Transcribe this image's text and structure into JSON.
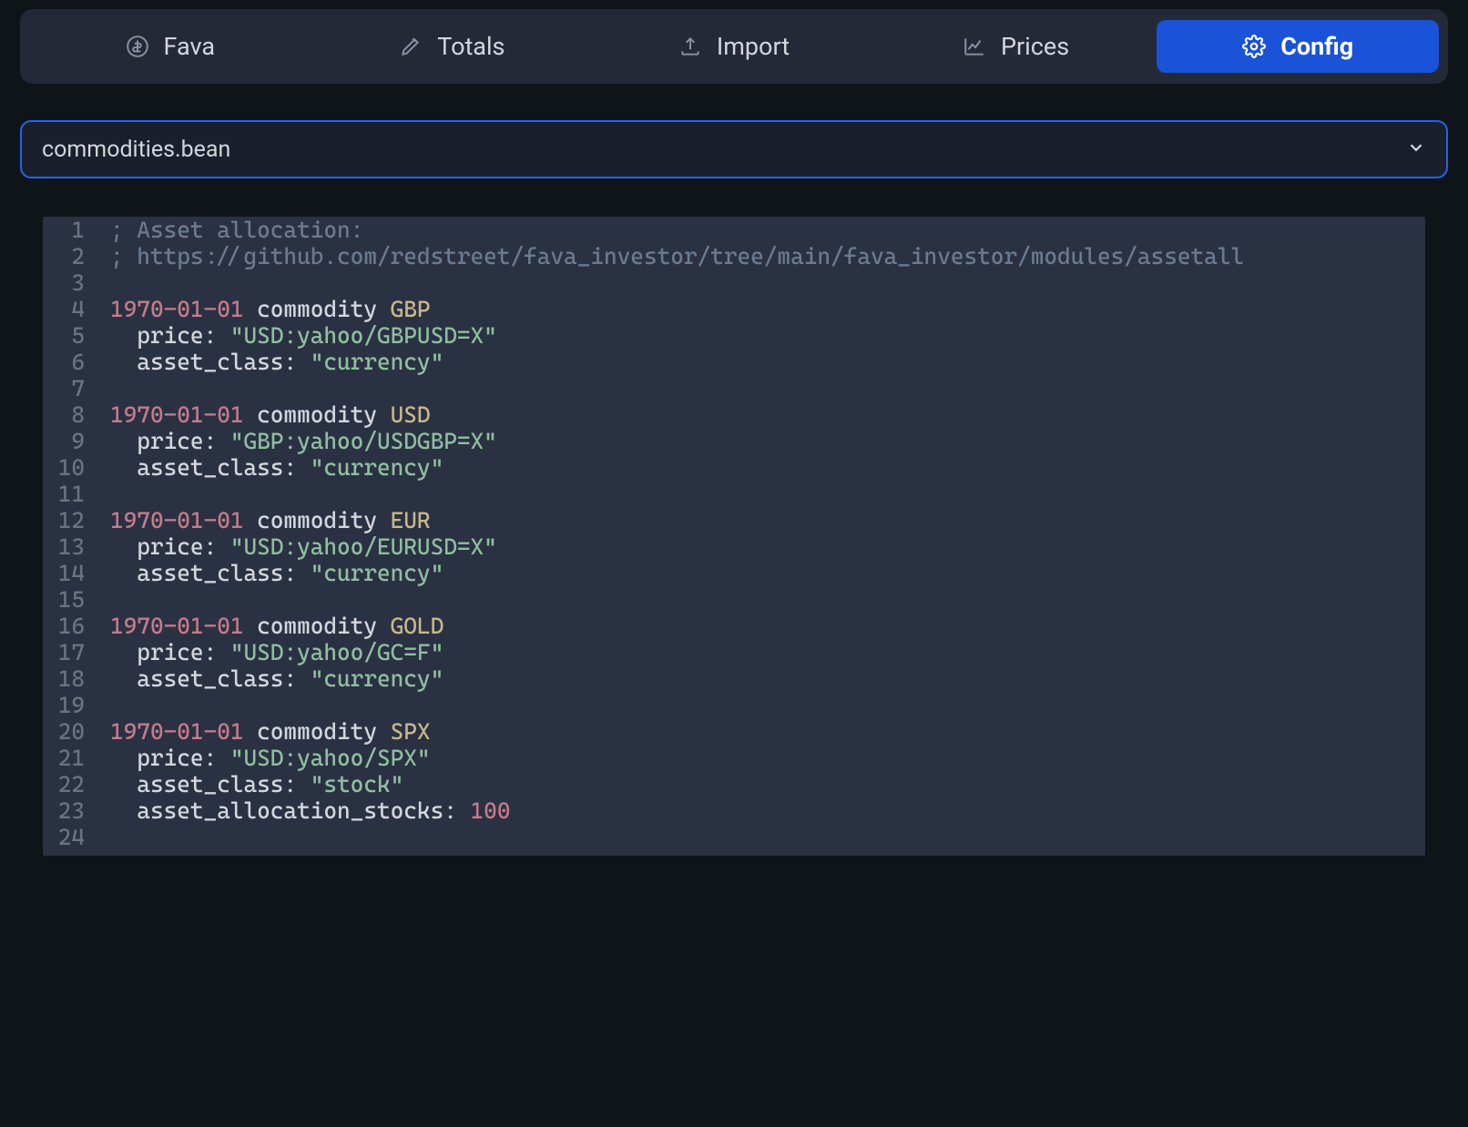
{
  "toolbar": {
    "tabs": [
      {
        "id": "fava",
        "label": "Fava",
        "icon": "dollar-circle-icon",
        "active": false
      },
      {
        "id": "totals",
        "label": "Totals",
        "icon": "pencil-icon",
        "active": false
      },
      {
        "id": "import",
        "label": "Import",
        "icon": "upload-icon",
        "active": false
      },
      {
        "id": "prices",
        "label": "Prices",
        "icon": "chart-line-icon",
        "active": false
      },
      {
        "id": "config",
        "label": "Config",
        "icon": "gear-icon",
        "active": true
      }
    ]
  },
  "file_select": {
    "value": "commodities.bean"
  },
  "editor": {
    "lines": [
      {
        "n": 1,
        "tokens": [
          {
            "t": "; Asset allocation:",
            "c": "comment"
          }
        ]
      },
      {
        "n": 2,
        "tokens": [
          {
            "t": "; https://github.com/redstreet/fava_investor/tree/main/fava_investor/modules/assetall",
            "c": "comment"
          }
        ]
      },
      {
        "n": 3,
        "tokens": []
      },
      {
        "n": 4,
        "tokens": [
          {
            "t": "1970-01-01",
            "c": "date"
          },
          {
            "t": " commodity ",
            "c": "kw"
          },
          {
            "t": "GBP",
            "c": "sym"
          }
        ]
      },
      {
        "n": 5,
        "tokens": [
          {
            "t": "  price: ",
            "c": "attr"
          },
          {
            "t": "\"USD:yahoo/GBPUSD=X\"",
            "c": "str"
          }
        ]
      },
      {
        "n": 6,
        "tokens": [
          {
            "t": "  asset_class: ",
            "c": "attr"
          },
          {
            "t": "\"currency\"",
            "c": "str"
          }
        ]
      },
      {
        "n": 7,
        "tokens": []
      },
      {
        "n": 8,
        "tokens": [
          {
            "t": "1970-01-01",
            "c": "date"
          },
          {
            "t": " commodity ",
            "c": "kw"
          },
          {
            "t": "USD",
            "c": "sym"
          }
        ]
      },
      {
        "n": 9,
        "tokens": [
          {
            "t": "  price: ",
            "c": "attr"
          },
          {
            "t": "\"GBP:yahoo/USDGBP=X\"",
            "c": "str"
          }
        ]
      },
      {
        "n": 10,
        "tokens": [
          {
            "t": "  asset_class: ",
            "c": "attr"
          },
          {
            "t": "\"currency\"",
            "c": "str"
          }
        ]
      },
      {
        "n": 11,
        "tokens": []
      },
      {
        "n": 12,
        "tokens": [
          {
            "t": "1970-01-01",
            "c": "date"
          },
          {
            "t": " commodity ",
            "c": "kw"
          },
          {
            "t": "EUR",
            "c": "sym"
          }
        ]
      },
      {
        "n": 13,
        "tokens": [
          {
            "t": "  price: ",
            "c": "attr"
          },
          {
            "t": "\"USD:yahoo/EURUSD=X\"",
            "c": "str"
          }
        ]
      },
      {
        "n": 14,
        "tokens": [
          {
            "t": "  asset_class: ",
            "c": "attr"
          },
          {
            "t": "\"currency\"",
            "c": "str"
          }
        ]
      },
      {
        "n": 15,
        "tokens": []
      },
      {
        "n": 16,
        "tokens": [
          {
            "t": "1970-01-01",
            "c": "date"
          },
          {
            "t": " commodity ",
            "c": "kw"
          },
          {
            "t": "GOLD",
            "c": "sym"
          }
        ]
      },
      {
        "n": 17,
        "tokens": [
          {
            "t": "  price: ",
            "c": "attr"
          },
          {
            "t": "\"USD:yahoo/GC=F\"",
            "c": "str"
          }
        ]
      },
      {
        "n": 18,
        "tokens": [
          {
            "t": "  asset_class: ",
            "c": "attr"
          },
          {
            "t": "\"currency\"",
            "c": "str"
          }
        ]
      },
      {
        "n": 19,
        "tokens": []
      },
      {
        "n": 20,
        "tokens": [
          {
            "t": "1970-01-01",
            "c": "date"
          },
          {
            "t": " commodity ",
            "c": "kw"
          },
          {
            "t": "SPX",
            "c": "sym"
          }
        ]
      },
      {
        "n": 21,
        "tokens": [
          {
            "t": "  price: ",
            "c": "attr"
          },
          {
            "t": "\"USD:yahoo/SPX\"",
            "c": "str"
          }
        ]
      },
      {
        "n": 22,
        "tokens": [
          {
            "t": "  asset_class: ",
            "c": "attr"
          },
          {
            "t": "\"stock\"",
            "c": "str"
          }
        ]
      },
      {
        "n": 23,
        "tokens": [
          {
            "t": "  asset_allocation_stocks: ",
            "c": "attr"
          },
          {
            "t": "100",
            "c": "num"
          }
        ]
      },
      {
        "n": 24,
        "tokens": []
      }
    ]
  }
}
